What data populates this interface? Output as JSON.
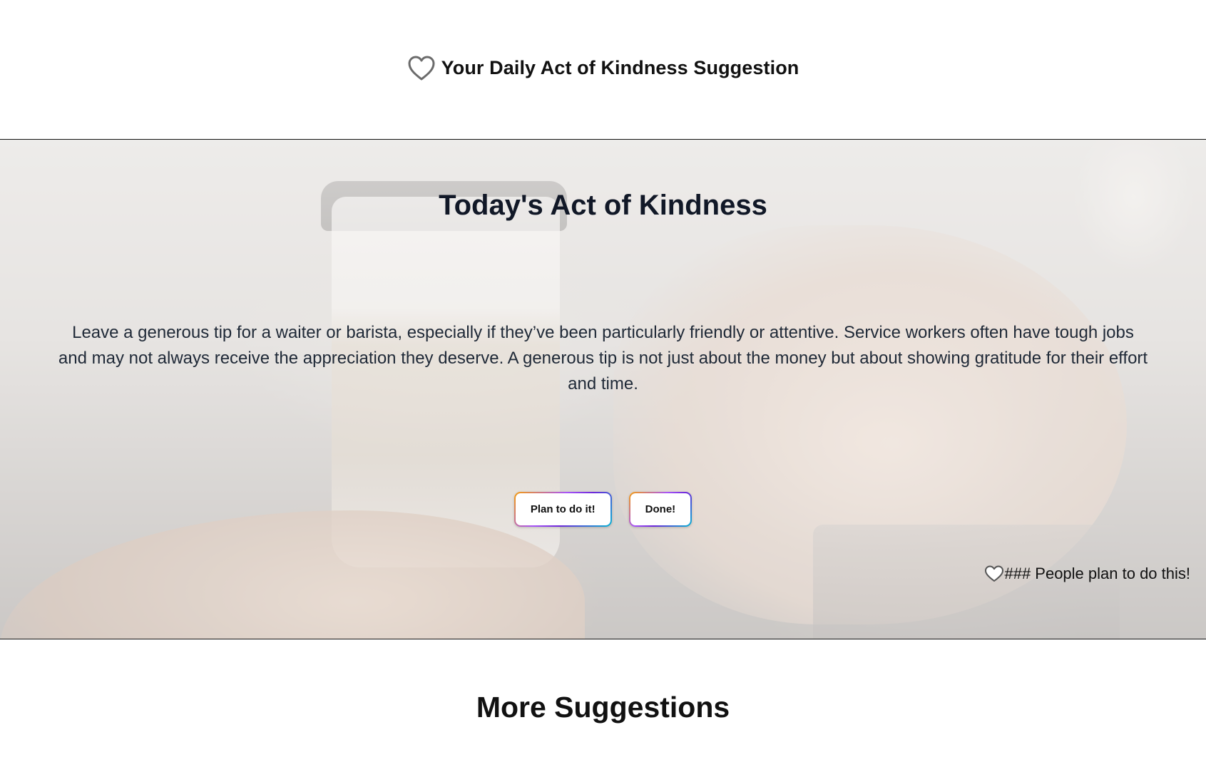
{
  "header": {
    "icon": "heart-outline-icon",
    "title": "Your Daily Act of Kindness Suggestion"
  },
  "hero": {
    "heading": "Today's Act of Kindness",
    "suggestion": "Leave a generous tip for a waiter or barista, especially if they’ve been particularly friendly or attentive. Service workers often have tough jobs and may not always receive the appreciation they deserve. A generous tip is not just about the money but about showing gratitude for their effort and time.",
    "plan_button": "Plan to do it!",
    "done_button": "Done!",
    "people_count_icon": "heart-outline-icon",
    "people_count_text": "### People plan to do this!"
  },
  "more": {
    "heading": "More Suggestions"
  },
  "colors": {
    "text": "#111827",
    "button_gradient": [
      "#f59e0b",
      "#a855f7",
      "#6d28d9",
      "#06b6d4"
    ],
    "icon_stroke": "#6b6b6b"
  }
}
